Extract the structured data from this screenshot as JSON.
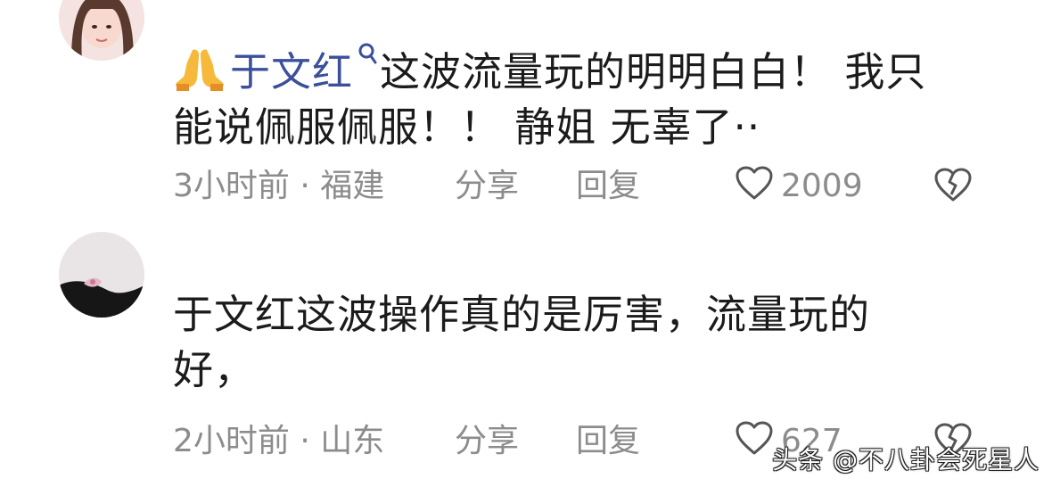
{
  "comments": [
    {
      "author": "于文红",
      "text_line1": "这波流量玩的明明白白！ 我只",
      "text_line2": "能说佩服佩服！！ 静姐 无辜了··",
      "time": "3小时前",
      "separator": "·",
      "location": "福建",
      "share_label": "分享",
      "reply_label": "回复",
      "likes": "2009"
    },
    {
      "text_line1": "于文红这波操作真的是厉害，流量玩的",
      "text_line2": "好，",
      "time": "2小时前",
      "separator": "·",
      "location": "山东",
      "share_label": "分享",
      "reply_label": "回复",
      "likes": "627"
    }
  ],
  "watermark": "头条 @不八卦会死星人",
  "icons": {
    "pray": "pray-hands-emoji",
    "search": "search-icon",
    "like": "heart-outline-icon",
    "dislike": "broken-heart-icon"
  },
  "colors": {
    "text": "#1b1b1b",
    "author_link": "#3b4f9a",
    "meta": "#8c8c8c"
  }
}
